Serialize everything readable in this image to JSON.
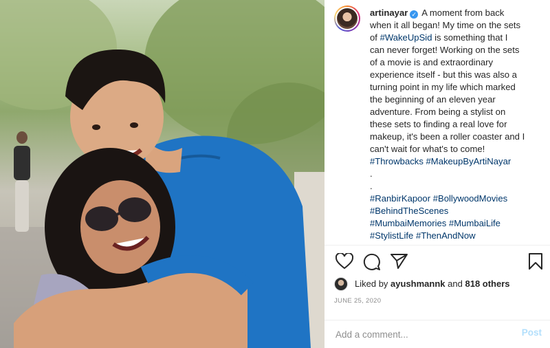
{
  "post": {
    "photo_alt": "",
    "author": "artinayar",
    "verified": true,
    "caption_lines": [
      "A moment from back",
      "when it all began! My time on the sets",
      "of #WakeUpSid is something that I",
      "can never forget! Working on the sets",
      "of a movie is and extraordinary",
      "experience itself - but this was also a",
      "turning point in my life which marked",
      "the beginning of an eleven year",
      "adventure. From being a stylist on",
      "these sets to finding a real love for",
      "makeup, it's been a roller coaster and I",
      "can't wait for what's to come!"
    ],
    "caption_parts": {
      "line3_prefix": "of ",
      "line3_tag": "#WakeUpSid",
      "line3_suffix": " is something that I"
    },
    "hashtag_lines": [
      "#Throwbacks #MakeupByArtiNayar",
      ".",
      ".",
      "#RanbirKapoor #BollywoodMovies",
      "#BehindTheScenes",
      "#MumbaiMemories #MumbaiLife",
      "#StylistLife #ThenAndNow"
    ],
    "likes": {
      "prefix": "Liked by",
      "user": "ayushmannk",
      "joiner": "and",
      "others": "818 others"
    },
    "date": "JUNE 25, 2020",
    "comment": {
      "placeholder": "Add a comment...",
      "post_label": "Post"
    },
    "icons": [
      "heart-icon",
      "comment-icon",
      "share-icon",
      "bookmark-icon",
      "verified-icon"
    ],
    "colors": {
      "hashtag": "#00376b",
      "verified": "#3897f0",
      "post_button": "#b2dffc",
      "muted": "#8e8e8e",
      "shirt_blue": "#1f74c4"
    }
  }
}
